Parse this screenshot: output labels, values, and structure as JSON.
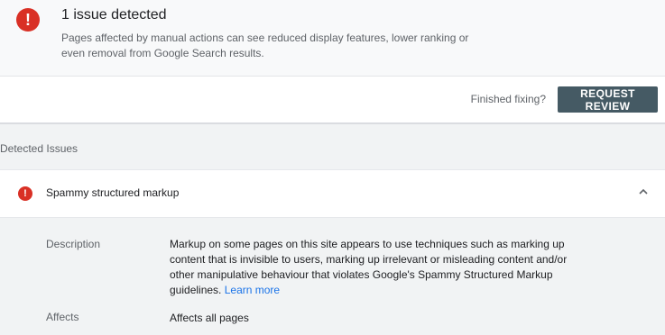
{
  "summary": {
    "icon": "alert-error-icon",
    "icon_glyph": "!",
    "title": "1 issue detected",
    "description": "Pages affected by manual actions can see reduced display features, lower ranking or even removal from Google Search results."
  },
  "action_bar": {
    "prompt": "Finished fixing?",
    "button_label": "REQUEST REVIEW"
  },
  "issues_section": {
    "title": "Detected Issues"
  },
  "issue": {
    "icon": "error-icon",
    "icon_glyph": "!",
    "title": "Spammy structured markup",
    "expanded": true,
    "description_label": "Description",
    "description_text": "Markup on some pages on this site appears to use techniques such as marking up content that is invisible to users, marking up irrelevant or misleading content and/or other manipulative behaviour that violates Google's Spammy Structured Markup guidelines.",
    "learn_more": "Learn more",
    "affects_label": "Affects",
    "affects_value": "Affects all pages"
  },
  "colors": {
    "error": "#d93025",
    "button": "#455a64",
    "link": "#1a73e8"
  }
}
